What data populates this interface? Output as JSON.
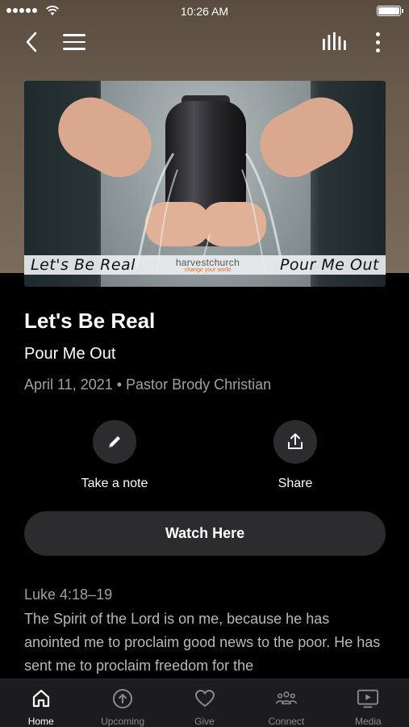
{
  "status_bar": {
    "time": "10:26 AM"
  },
  "artwork": {
    "banner_left": "Let's Be Real",
    "banner_right": "Pour Me Out",
    "church_name": "harvestchurch",
    "church_tagline": "change your world"
  },
  "sermon": {
    "title": "Let's Be Real",
    "subtitle": "Pour Me Out",
    "meta": "April 11, 2021 • Pastor Brody Christian"
  },
  "actions": {
    "note_label": "Take a note",
    "share_label": "Share",
    "watch_label": "Watch Here"
  },
  "scripture": {
    "reference": "Luke 4:18–19",
    "text": "The Spirit of the Lord is on me, because he has anointed me to proclaim good news to the poor. He has sent me to proclaim freedom for the"
  },
  "tabs": [
    {
      "label": "Home",
      "icon": "home-icon",
      "active": true
    },
    {
      "label": "Upcoming",
      "icon": "upcoming-icon",
      "active": false
    },
    {
      "label": "Give",
      "icon": "heart-icon",
      "active": false
    },
    {
      "label": "Connect",
      "icon": "people-icon",
      "active": false
    },
    {
      "label": "Media",
      "icon": "media-icon",
      "active": false
    }
  ],
  "colors": {
    "header_bg": "#6b5d4e",
    "button_bg": "#2c2c2e",
    "tab_bar_bg": "#1c1c1e",
    "secondary_text": "#a0a0a0"
  }
}
